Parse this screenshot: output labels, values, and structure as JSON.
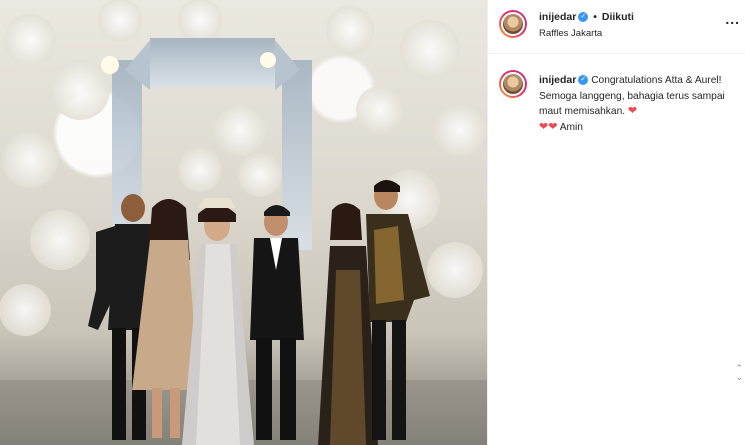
{
  "post": {
    "username": "inijedar",
    "verified_symbol": "✓",
    "separator": "•",
    "follow_status": "Diikuti",
    "location": "Raffles Jakarta",
    "more_symbol": "...",
    "image_alt": "Foto pernikahan di Raffles Jakarta"
  },
  "caption": {
    "username": "inijedar",
    "text": "Congratulations Atta & Aurel! Semoga langgeng, bahagia terus sampai maut memisahkan.",
    "heart": "❤",
    "amin": "Amin"
  },
  "colors": {
    "verified_blue": "#3897f0",
    "heart_red": "#ed4956",
    "text": "#262626"
  },
  "icons": {
    "verified": "verified-badge-icon",
    "heart": "heart-icon",
    "more": "more-options-icon"
  }
}
